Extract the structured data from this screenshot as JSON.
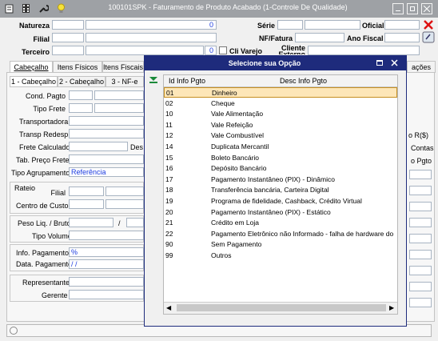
{
  "window": {
    "title": "100101SPK - Faturamento de Produto Acabado (1-Controle De Qualidade)"
  },
  "header": {
    "natureza_label": "Natureza",
    "natureza_value": "0",
    "filial_label": "Filial",
    "terceiro_label": "Terceiro",
    "terceiro_value": "0",
    "cli_varejo_label": "Cli Varejo",
    "serie_label": "Série",
    "oficial_label": "Oficial",
    "nf_fatura_label": "NF/Fatura",
    "ano_fiscal_label": "Ano Fiscal",
    "cliente_label": "Cliente",
    "cliente_label2": "Externo"
  },
  "tabs": [
    "Cabeçalho",
    "Itens Físicos",
    "Itens Fiscais"
  ],
  "tabs_right": "ações",
  "subtabs": [
    "1 - Cabeçalho",
    "2 - Cabeçalho",
    "3 - NF-e"
  ],
  "form": {
    "cond_pagto": "Cond. Pagto",
    "tipo_frete": "Tipo Frete",
    "transportadora": "Transportadora",
    "transp_redesp": "Transp Redesp.",
    "frete_calculado": "Frete Calculado",
    "frete_des": "Des",
    "tab_preco_frete": "Tab. Preço Frete",
    "tipo_agrupamento": "Tipo Agrupamento",
    "tipo_agrupamento_value": "Referência",
    "rateio": "Rateio",
    "filial": "Filial",
    "centro_custo": "Centro de Custo",
    "peso_liq_bruto": "Peso Liq. / Bruto",
    "peso_sep": "/",
    "tipo_volume": "Tipo Volume",
    "info_pagamento": "Info. Pagamento",
    "info_pagamento_value": "%",
    "data_pagamento": "Data. Pagamento",
    "data_pagamento_value": "/ /",
    "representante": "Representante",
    "gerente": "Gerente"
  },
  "right_panel": {
    "r_label": "o R($)",
    "contas": "Contas",
    "pgto": "o Pgto"
  },
  "modal": {
    "title": "Selecione sua Opção",
    "col1": "Id Info Pgto",
    "col2": "Desc Info Pgto",
    "rows": [
      {
        "id": "01",
        "desc": "Dinheiro"
      },
      {
        "id": "02",
        "desc": "Cheque"
      },
      {
        "id": "10",
        "desc": "Vale Alimentação"
      },
      {
        "id": "11",
        "desc": "Vale Refeição"
      },
      {
        "id": "12",
        "desc": "Vale Combustível"
      },
      {
        "id": "14",
        "desc": "Duplicata Mercantil"
      },
      {
        "id": "15",
        "desc": "Boleto Bancário"
      },
      {
        "id": "16",
        "desc": "Depósito Bancário"
      },
      {
        "id": "17",
        "desc": "Pagamento Instantâneo (PIX) - Dinâmico"
      },
      {
        "id": "18",
        "desc": "Transferência bancária, Carteira Digital"
      },
      {
        "id": "19",
        "desc": "Programa de fidelidade, Cashback, Crédito Virtual"
      },
      {
        "id": "20",
        "desc": "Pagamento Instantâneo (PIX) - Estático"
      },
      {
        "id": "21",
        "desc": "Crédito em Loja"
      },
      {
        "id": "22",
        "desc": "Pagamento Eletrônico não Informado - falha de hardware do s"
      },
      {
        "id": "90",
        "desc": "Sem Pagamento"
      },
      {
        "id": "99",
        "desc": "Outros"
      }
    ]
  },
  "colors": {
    "modal_title_bg": "#1e2b7c",
    "selection": "#fde6b8",
    "value_text": "#1a3adf"
  }
}
